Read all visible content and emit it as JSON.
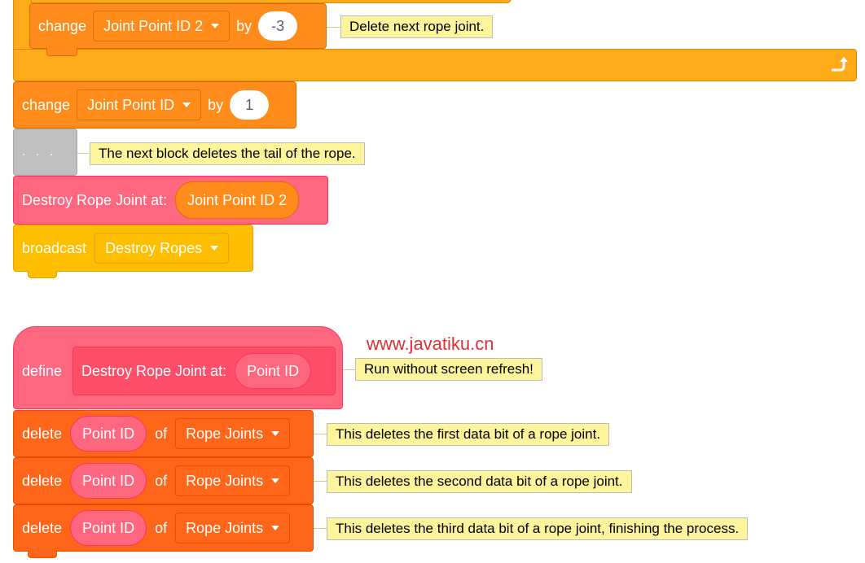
{
  "blocks": {
    "change_joint2": {
      "word": "change",
      "variable": "Joint Point ID 2",
      "by": "by",
      "value": "-3",
      "comment": "Delete next rope joint."
    },
    "change_joint": {
      "word": "change",
      "variable": "Joint Point ID",
      "by": "by",
      "value": "1"
    },
    "ellipsis": {
      "label": ". . .",
      "comment": "The next block deletes the tail of the rope."
    },
    "destroy_call": {
      "label": "Destroy Rope Joint at:",
      "arg": "Joint Point ID 2"
    },
    "broadcast": {
      "word": "broadcast",
      "message": "Destroy Ropes"
    },
    "define": {
      "word": "define",
      "proc_label": "Destroy Rope Joint at:",
      "param": "Point ID",
      "comment": "Run without screen refresh!"
    },
    "delete_rows": [
      {
        "word": "delete",
        "item": "Point ID",
        "of": "of",
        "list": "Rope Joints",
        "comment": "This deletes the first data bit of a rope joint."
      },
      {
        "word": "delete",
        "item": "Point ID",
        "of": "of",
        "list": "Rope Joints",
        "comment": "This deletes the second data bit of a rope joint."
      },
      {
        "word": "delete",
        "item": "Point ID",
        "of": "of",
        "list": "Rope Joints",
        "comment": "This deletes the third data bit of a rope joint, finishing the process."
      }
    ]
  },
  "watermark": "www.javatiku.cn",
  "icons": {
    "loop_arrow": "loop-arrow-icon",
    "dropdown": "dropdown-caret-icon"
  },
  "colors": {
    "variables": "#ff8c1a",
    "control": "#ffab19",
    "custom": "#ff6680",
    "lists": "#ff661a",
    "events": "#ffbf00",
    "comment": "#fef49c"
  }
}
